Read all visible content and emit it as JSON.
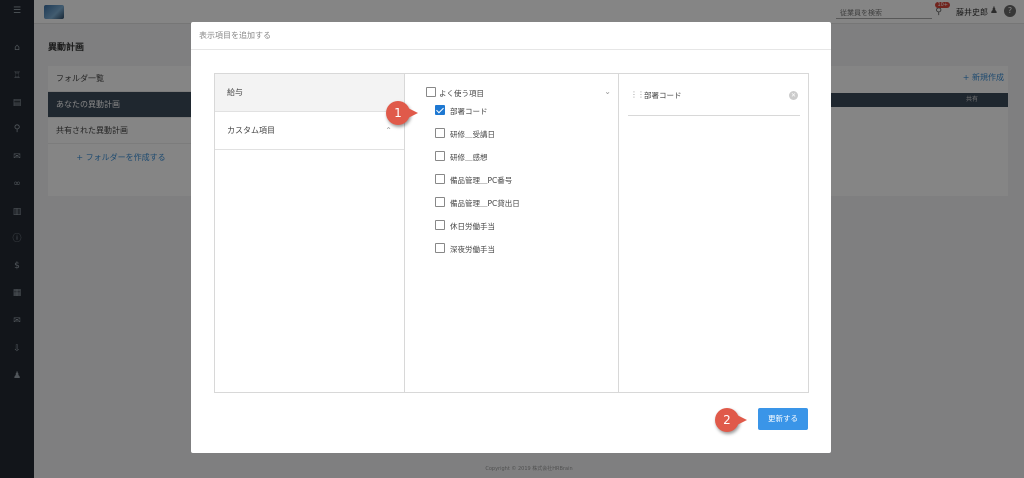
{
  "topbar": {
    "search_placeholder": "従業員を検索",
    "notification_count": "10+",
    "user_name": "藤井史郎"
  },
  "page": {
    "title": "異動計画",
    "folders": [
      "フォルダ一覧",
      "あなたの異動計画",
      "共有された異動計画"
    ],
    "create_folder": "+ フォルダーを作成する",
    "new_button": "+ 新規作成",
    "table_header": "共有",
    "copyright": "Copyright © 2019 株式会社HRBrain"
  },
  "modal": {
    "title": "表示項目を追加する",
    "categories": [
      "給与",
      "カスタム項目"
    ],
    "group_label": "よく使う項目",
    "items": [
      {
        "label": "部署コード",
        "checked": true
      },
      {
        "label": "研修＿受講日",
        "checked": false
      },
      {
        "label": "研修＿感想",
        "checked": false
      },
      {
        "label": "備品管理＿PC番号",
        "checked": false
      },
      {
        "label": "備品管理＿PC貸出日",
        "checked": false
      },
      {
        "label": "休日労働手当",
        "checked": false
      },
      {
        "label": "深夜労働手当",
        "checked": false
      }
    ],
    "selected": [
      "部署コード"
    ],
    "update_button": "更新する"
  },
  "callouts": [
    "1",
    "2"
  ],
  "colors": {
    "primary": "#3a95e8",
    "checkbox": "#1e78d2",
    "callout": "#e05a4a",
    "sidebar": "#232a33"
  }
}
